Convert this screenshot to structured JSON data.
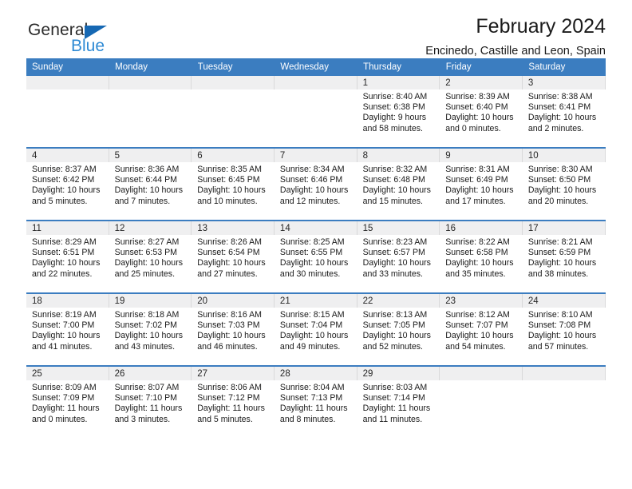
{
  "brand": {
    "name_top": "General",
    "name_bottom": "Blue",
    "flag_color": "#1668b3",
    "blue_text_color": "#2e8ad4"
  },
  "header": {
    "title": "February 2024",
    "subtitle": "Encinedo, Castille and Leon, Spain"
  },
  "theme": {
    "header_bg": "#3b7dc0",
    "daynum_bg": "#efeff0",
    "row_divider": "#3b7dc0"
  },
  "weekdays": [
    "Sunday",
    "Monday",
    "Tuesday",
    "Wednesday",
    "Thursday",
    "Friday",
    "Saturday"
  ],
  "labels": {
    "sunrise_prefix": "Sunrise:",
    "sunset_prefix": "Sunset:",
    "daylight_prefix": "Daylight:"
  },
  "weeks": [
    [
      {
        "day": "",
        "line1": "",
        "line2": "",
        "line3": "",
        "line4": ""
      },
      {
        "day": "",
        "line1": "",
        "line2": "",
        "line3": "",
        "line4": ""
      },
      {
        "day": "",
        "line1": "",
        "line2": "",
        "line3": "",
        "line4": ""
      },
      {
        "day": "",
        "line1": "",
        "line2": "",
        "line3": "",
        "line4": ""
      },
      {
        "day": "1",
        "line1": "Sunrise: 8:40 AM",
        "line2": "Sunset: 6:38 PM",
        "line3": "Daylight: 9 hours",
        "line4": "and 58 minutes."
      },
      {
        "day": "2",
        "line1": "Sunrise: 8:39 AM",
        "line2": "Sunset: 6:40 PM",
        "line3": "Daylight: 10 hours",
        "line4": "and 0 minutes."
      },
      {
        "day": "3",
        "line1": "Sunrise: 8:38 AM",
        "line2": "Sunset: 6:41 PM",
        "line3": "Daylight: 10 hours",
        "line4": "and 2 minutes."
      }
    ],
    [
      {
        "day": "4",
        "line1": "Sunrise: 8:37 AM",
        "line2": "Sunset: 6:42 PM",
        "line3": "Daylight: 10 hours",
        "line4": "and 5 minutes."
      },
      {
        "day": "5",
        "line1": "Sunrise: 8:36 AM",
        "line2": "Sunset: 6:44 PM",
        "line3": "Daylight: 10 hours",
        "line4": "and 7 minutes."
      },
      {
        "day": "6",
        "line1": "Sunrise: 8:35 AM",
        "line2": "Sunset: 6:45 PM",
        "line3": "Daylight: 10 hours",
        "line4": "and 10 minutes."
      },
      {
        "day": "7",
        "line1": "Sunrise: 8:34 AM",
        "line2": "Sunset: 6:46 PM",
        "line3": "Daylight: 10 hours",
        "line4": "and 12 minutes."
      },
      {
        "day": "8",
        "line1": "Sunrise: 8:32 AM",
        "line2": "Sunset: 6:48 PM",
        "line3": "Daylight: 10 hours",
        "line4": "and 15 minutes."
      },
      {
        "day": "9",
        "line1": "Sunrise: 8:31 AM",
        "line2": "Sunset: 6:49 PM",
        "line3": "Daylight: 10 hours",
        "line4": "and 17 minutes."
      },
      {
        "day": "10",
        "line1": "Sunrise: 8:30 AM",
        "line2": "Sunset: 6:50 PM",
        "line3": "Daylight: 10 hours",
        "line4": "and 20 minutes."
      }
    ],
    [
      {
        "day": "11",
        "line1": "Sunrise: 8:29 AM",
        "line2": "Sunset: 6:51 PM",
        "line3": "Daylight: 10 hours",
        "line4": "and 22 minutes."
      },
      {
        "day": "12",
        "line1": "Sunrise: 8:27 AM",
        "line2": "Sunset: 6:53 PM",
        "line3": "Daylight: 10 hours",
        "line4": "and 25 minutes."
      },
      {
        "day": "13",
        "line1": "Sunrise: 8:26 AM",
        "line2": "Sunset: 6:54 PM",
        "line3": "Daylight: 10 hours",
        "line4": "and 27 minutes."
      },
      {
        "day": "14",
        "line1": "Sunrise: 8:25 AM",
        "line2": "Sunset: 6:55 PM",
        "line3": "Daylight: 10 hours",
        "line4": "and 30 minutes."
      },
      {
        "day": "15",
        "line1": "Sunrise: 8:23 AM",
        "line2": "Sunset: 6:57 PM",
        "line3": "Daylight: 10 hours",
        "line4": "and 33 minutes."
      },
      {
        "day": "16",
        "line1": "Sunrise: 8:22 AM",
        "line2": "Sunset: 6:58 PM",
        "line3": "Daylight: 10 hours",
        "line4": "and 35 minutes."
      },
      {
        "day": "17",
        "line1": "Sunrise: 8:21 AM",
        "line2": "Sunset: 6:59 PM",
        "line3": "Daylight: 10 hours",
        "line4": "and 38 minutes."
      }
    ],
    [
      {
        "day": "18",
        "line1": "Sunrise: 8:19 AM",
        "line2": "Sunset: 7:00 PM",
        "line3": "Daylight: 10 hours",
        "line4": "and 41 minutes."
      },
      {
        "day": "19",
        "line1": "Sunrise: 8:18 AM",
        "line2": "Sunset: 7:02 PM",
        "line3": "Daylight: 10 hours",
        "line4": "and 43 minutes."
      },
      {
        "day": "20",
        "line1": "Sunrise: 8:16 AM",
        "line2": "Sunset: 7:03 PM",
        "line3": "Daylight: 10 hours",
        "line4": "and 46 minutes."
      },
      {
        "day": "21",
        "line1": "Sunrise: 8:15 AM",
        "line2": "Sunset: 7:04 PM",
        "line3": "Daylight: 10 hours",
        "line4": "and 49 minutes."
      },
      {
        "day": "22",
        "line1": "Sunrise: 8:13 AM",
        "line2": "Sunset: 7:05 PM",
        "line3": "Daylight: 10 hours",
        "line4": "and 52 minutes."
      },
      {
        "day": "23",
        "line1": "Sunrise: 8:12 AM",
        "line2": "Sunset: 7:07 PM",
        "line3": "Daylight: 10 hours",
        "line4": "and 54 minutes."
      },
      {
        "day": "24",
        "line1": "Sunrise: 8:10 AM",
        "line2": "Sunset: 7:08 PM",
        "line3": "Daylight: 10 hours",
        "line4": "and 57 minutes."
      }
    ],
    [
      {
        "day": "25",
        "line1": "Sunrise: 8:09 AM",
        "line2": "Sunset: 7:09 PM",
        "line3": "Daylight: 11 hours",
        "line4": "and 0 minutes."
      },
      {
        "day": "26",
        "line1": "Sunrise: 8:07 AM",
        "line2": "Sunset: 7:10 PM",
        "line3": "Daylight: 11 hours",
        "line4": "and 3 minutes."
      },
      {
        "day": "27",
        "line1": "Sunrise: 8:06 AM",
        "line2": "Sunset: 7:12 PM",
        "line3": "Daylight: 11 hours",
        "line4": "and 5 minutes."
      },
      {
        "day": "28",
        "line1": "Sunrise: 8:04 AM",
        "line2": "Sunset: 7:13 PM",
        "line3": "Daylight: 11 hours",
        "line4": "and 8 minutes."
      },
      {
        "day": "29",
        "line1": "Sunrise: 8:03 AM",
        "line2": "Sunset: 7:14 PM",
        "line3": "Daylight: 11 hours",
        "line4": "and 11 minutes."
      },
      {
        "day": "",
        "line1": "",
        "line2": "",
        "line3": "",
        "line4": ""
      },
      {
        "day": "",
        "line1": "",
        "line2": "",
        "line3": "",
        "line4": ""
      }
    ]
  ]
}
